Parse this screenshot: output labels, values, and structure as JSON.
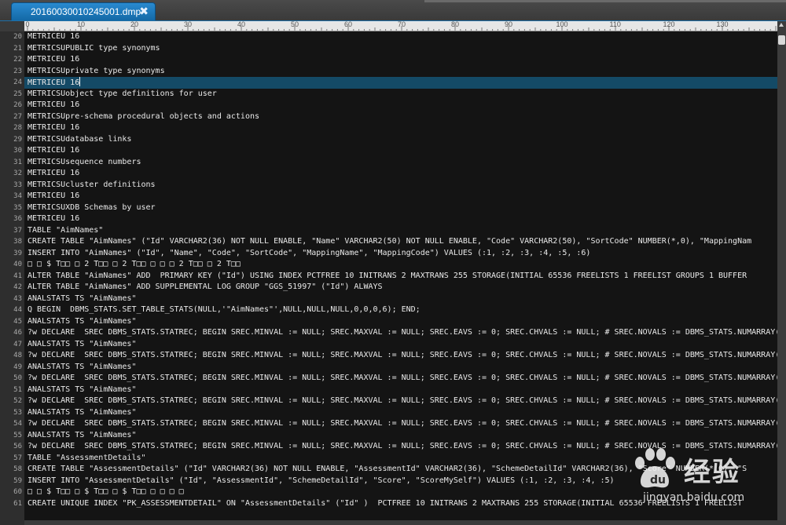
{
  "tab": {
    "title": "20160030010245001.dmp",
    "close_label": "✖"
  },
  "ruler": {
    "labels": [
      "0",
      "10",
      "20",
      "30",
      "40",
      "50",
      "60",
      "70",
      "80",
      "90",
      "100",
      "110",
      "120",
      "130",
      "140"
    ]
  },
  "editor": {
    "highlighted_line": 24,
    "lines": [
      {
        "n": "20",
        "text": "METRICEU 16"
      },
      {
        "n": "21",
        "text": "METRICSUPUBLIC type synonyms"
      },
      {
        "n": "22",
        "text": "METRICEU 16"
      },
      {
        "n": "23",
        "text": "METRICSUprivate type synonyms"
      },
      {
        "n": "24",
        "text": "METRICEU 16"
      },
      {
        "n": "25",
        "text": "METRICSUobject type definitions for user"
      },
      {
        "n": "26",
        "text": "METRICEU 16"
      },
      {
        "n": "27",
        "text": "METRICSUpre-schema procedural objects and actions"
      },
      {
        "n": "28",
        "text": "METRICEU 16"
      },
      {
        "n": "29",
        "text": "METRICSUdatabase links"
      },
      {
        "n": "30",
        "text": "METRICEU 16"
      },
      {
        "n": "31",
        "text": "METRICSUsequence numbers"
      },
      {
        "n": "32",
        "text": "METRICEU 16"
      },
      {
        "n": "33",
        "text": "METRICSUcluster definitions"
      },
      {
        "n": "34",
        "text": "METRICEU 16"
      },
      {
        "n": "35",
        "text": "METRICSUXDB Schemas by user"
      },
      {
        "n": "36",
        "text": "METRICEU 16"
      },
      {
        "n": "37",
        "text": "TABLE \"AimNames\""
      },
      {
        "n": "38",
        "text": "CREATE TABLE \"AimNames\" (\"Id\" VARCHAR2(36) NOT NULL ENABLE, \"Name\" VARCHAR2(50) NOT NULL ENABLE, \"Code\" VARCHAR2(50), \"SortCode\" NUMBER(*,0), \"MappingNam"
      },
      {
        "n": "39",
        "text": "INSERT INTO \"AimNames\" (\"Id\", \"Name\", \"Code\", \"SortCode\", \"MappingName\", \"MappingCode\") VALUES (:1, :2, :3, :4, :5, :6)"
      },
      {
        "n": "40",
        "text": "□ □ $ T□□ □ 2 T□□ □ 2 T□□ □ □ □ 2 T□□ □ 2 T□□"
      },
      {
        "n": "41",
        "text": "ALTER TABLE \"AimNames\" ADD  PRIMARY KEY (\"Id\") USING INDEX PCTFREE 10 INITRANS 2 MAXTRANS 255 STORAGE(INITIAL 65536 FREELISTS 1 FREELIST GROUPS 1 BUFFER"
      },
      {
        "n": "42",
        "text": "ALTER TABLE \"AimNames\" ADD SUPPLEMENTAL LOG GROUP \"GGS_51997\" (\"Id\") ALWAYS"
      },
      {
        "n": "43",
        "text": "ANALSTATS TS \"AimNames\""
      },
      {
        "n": "44",
        "text": "Q BEGIN  DBMS_STATS.SET_TABLE_STATS(NULL,'\"AimNames\"',NULL,NULL,NULL,0,0,0,6); END;"
      },
      {
        "n": "45",
        "text": "ANALSTATS TS \"AimNames\""
      },
      {
        "n": "46",
        "text": "?w DECLARE  SREC DBMS_STATS.STATREC; BEGIN SREC.MINVAL := NULL; SREC.MAXVAL := NULL; SREC.EAVS := 0; SREC.CHVALS := NULL; # SREC.NOVALS := DBMS_STATS.NUMARRAY("
      },
      {
        "n": "47",
        "text": "ANALSTATS TS \"AimNames\""
      },
      {
        "n": "48",
        "text": "?w DECLARE  SREC DBMS_STATS.STATREC; BEGIN SREC.MINVAL := NULL; SREC.MAXVAL := NULL; SREC.EAVS := 0; SREC.CHVALS := NULL; # SREC.NOVALS := DBMS_STATS.NUMARRAY("
      },
      {
        "n": "49",
        "text": "ANALSTATS TS \"AimNames\""
      },
      {
        "n": "50",
        "text": "?w DECLARE  SREC DBMS_STATS.STATREC; BEGIN SREC.MINVAL := NULL; SREC.MAXVAL := NULL; SREC.EAVS := 0; SREC.CHVALS := NULL; # SREC.NOVALS := DBMS_STATS.NUMARRAY("
      },
      {
        "n": "51",
        "text": "ANALSTATS TS \"AimNames\""
      },
      {
        "n": "52",
        "text": "?w DECLARE  SREC DBMS_STATS.STATREC; BEGIN SREC.MINVAL := NULL; SREC.MAXVAL := NULL; SREC.EAVS := 0; SREC.CHVALS := NULL; # SREC.NOVALS := DBMS_STATS.NUMARRAY("
      },
      {
        "n": "53",
        "text": "ANALSTATS TS \"AimNames\""
      },
      {
        "n": "54",
        "text": "?w DECLARE  SREC DBMS_STATS.STATREC; BEGIN SREC.MINVAL := NULL; SREC.MAXVAL := NULL; SREC.EAVS := 0; SREC.CHVALS := NULL; # SREC.NOVALS := DBMS_STATS.NUMARRAY("
      },
      {
        "n": "55",
        "text": "ANALSTATS TS \"AimNames\""
      },
      {
        "n": "56",
        "text": "?w DECLARE  SREC DBMS_STATS.STATREC; BEGIN SREC.MINVAL := NULL; SREC.MAXVAL := NULL; SREC.EAVS := 0; SREC.CHVALS := NULL; # SREC.NOVALS := DBMS_STATS.NUMARRAY("
      },
      {
        "n": "57",
        "text": "TABLE \"AssessmentDetails\""
      },
      {
        "n": "58",
        "text": "CREATE TABLE \"AssessmentDetails\" (\"Id\" VARCHAR2(36) NOT NULL ENABLE, \"AssessmentId\" VARCHAR2(36), \"SchemeDetailId\" VARCHAR2(36), \"Score\" NUMBER(*,0), \"S"
      },
      {
        "n": "59",
        "text": "INSERT INTO \"AssessmentDetails\" (\"Id\", \"AssessmentId\", \"SchemeDetailId\", \"Score\", \"ScoreMySelf\") VALUES (:1, :2, :3, :4, :5)"
      },
      {
        "n": "60",
        "text": "□ □ $ T□□ □ $ T□□ □ $ T□□ □ □ □ □"
      },
      {
        "n": "61",
        "text": "CREATE UNIQUE INDEX \"PK_ASSESSMENTDETAIL\" ON \"AssessmentDetails\" (\"Id\" )  PCTFREE 10 INITRANS 2 MAXTRANS 255 STORAGE(INITIAL 65536 FREELISTS 1 FREELIST"
      }
    ]
  },
  "watermark": {
    "brand": "经验",
    "url": "jingyan.baidu.com"
  },
  "colors": {
    "editor_bg": "#141414",
    "highlight": "#144a66",
    "tab_blue": "#1c7bc0",
    "text": "#eaeaea"
  }
}
